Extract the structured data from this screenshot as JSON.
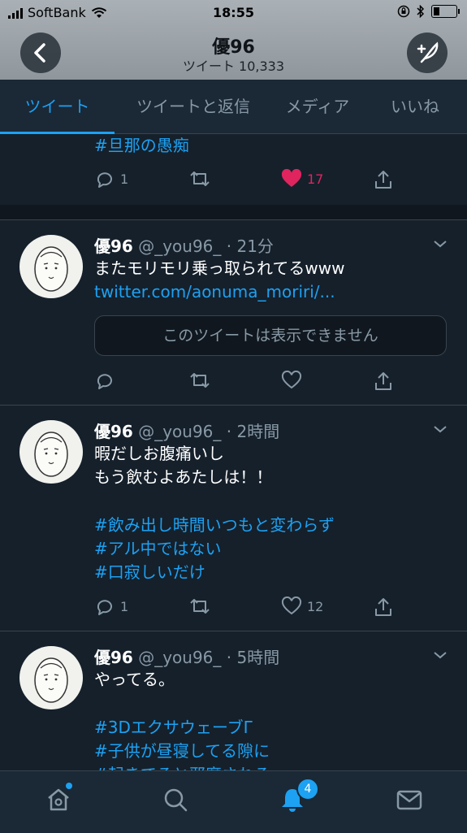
{
  "status_bar": {
    "carrier": "SoftBank",
    "time": "18:55"
  },
  "header": {
    "title": "優96",
    "subtitle": "ツイート 10,333",
    "back_icon": "chevron-left-icon",
    "compose_icon": "compose-feather-icon"
  },
  "tabs": [
    {
      "label": "ツイート",
      "active": true
    },
    {
      "label": "ツイートと返信",
      "active": false
    },
    {
      "label": "メディア",
      "active": false
    },
    {
      "label": "いいね",
      "active": false
    }
  ],
  "tweets": [
    {
      "partial_text": "#旦那の愚痴",
      "replies": "1",
      "retweets": "",
      "likes": "17",
      "liked": true
    },
    {
      "name": "優96",
      "handle": "@_you96_",
      "time": "· 21分",
      "line1": "またモリモリ乗っ取られてるwww",
      "link": "twitter.com/aonuma_moriri/...",
      "quote_unavailable": "このツイートは表示できません",
      "replies": "",
      "retweets": "",
      "likes": ""
    },
    {
      "name": "優96",
      "handle": "@_you96_",
      "time": "· 2時間",
      "line1": "暇だしお腹痛いし",
      "line2": "もう飲むよあたしは！！",
      "hashtags": [
        "#飲み出し時間いつもと変わらず",
        "#アル中ではない",
        "#口寂しいだけ"
      ],
      "replies": "1",
      "retweets": "",
      "likes": "12"
    },
    {
      "name": "優96",
      "handle": "@_you96_",
      "time": "· 5時間",
      "line1": "やってる。",
      "hashtags": [
        "#3DエクサウェーブГ",
        "#子供が昼寝してる隙に",
        "#起きてると邪魔される"
      ]
    }
  ],
  "bottom_nav": {
    "items": [
      "home-icon",
      "search-icon",
      "notifications-icon",
      "messages-icon"
    ],
    "notification_count": "4"
  },
  "colors": {
    "background": "#15202b",
    "accent": "#1da1f2",
    "like": "#e0245e",
    "muted": "#8899a6"
  }
}
